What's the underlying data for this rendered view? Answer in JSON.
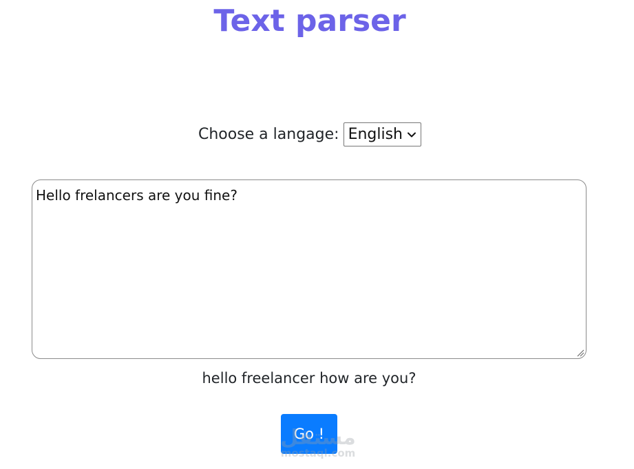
{
  "header": {
    "title": "Text parser"
  },
  "language": {
    "label": "Choose a langage:",
    "selected": "English"
  },
  "editor": {
    "value": "Hello frelancers are you fine?"
  },
  "result": {
    "text": "hello freelancer how are you?"
  },
  "actions": {
    "go_label": "Go !"
  },
  "watermark": {
    "arabic": "مستقل",
    "site": "mostaql.com"
  },
  "colors": {
    "title": "#6c63e8",
    "button": "#0a7cff",
    "watermark": "#9aa0a6"
  }
}
